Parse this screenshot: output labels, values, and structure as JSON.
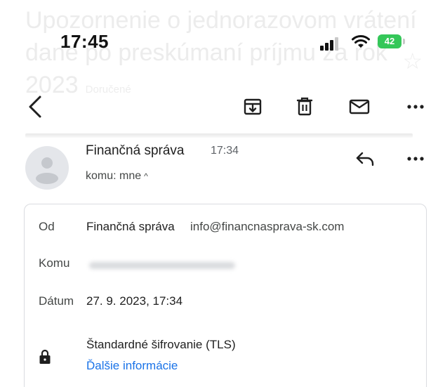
{
  "ghost_subject": {
    "text": "Upozornenie o jednorazovom vrátení dane po preskúmaní príjmu za rok 2023",
    "tag": "Doručené"
  },
  "status_bar": {
    "time": "17:45",
    "battery_level": "42"
  },
  "toolbar": {
    "icons": [
      "back-arrow-icon",
      "archive-icon",
      "trash-icon",
      "mail-icon",
      "more-icon"
    ]
  },
  "message": {
    "sender_name": "Finančná správa",
    "time": "17:34",
    "to_line": "komu: mne",
    "caret": "^"
  },
  "details": {
    "from_label": "Od",
    "from_name": "Finančná správa",
    "from_email": "info@financnasprava-sk.com",
    "to_label": "Komu",
    "date_label": "Dátum",
    "date_value": "27. 9. 2023, 17:34",
    "encryption": "Štandardné šifrovanie (TLS)",
    "more_info_link": "Ďalšie informácie"
  }
}
